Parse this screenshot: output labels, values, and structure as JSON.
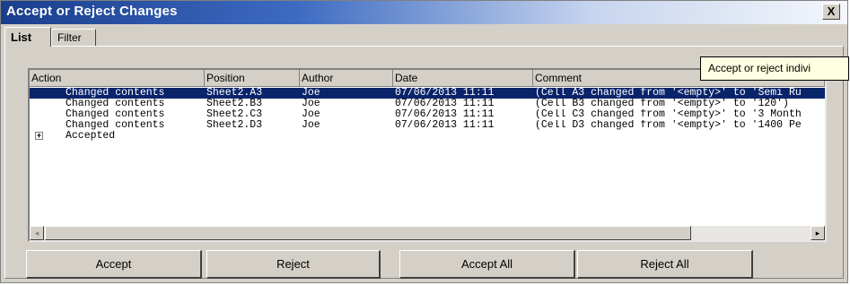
{
  "window": {
    "title": "Accept or Reject Changes",
    "close_label": "X"
  },
  "tabs": [
    {
      "label": "List",
      "active": true
    },
    {
      "label": "Filter",
      "active": false
    }
  ],
  "table": {
    "columns": [
      "Action",
      "Position",
      "Author",
      "Date",
      "Comment"
    ],
    "rows": [
      {
        "action": "Changed contents",
        "position": "Sheet2.A3",
        "author": "Joe",
        "date": "07/06/2013 11:11",
        "comment": "(Cell A3 changed from '<empty>' to 'Semi Ru",
        "selected": true
      },
      {
        "action": "Changed contents",
        "position": "Sheet2.B3",
        "author": "Joe",
        "date": "07/06/2013 11:11",
        "comment": "(Cell B3 changed from '<empty>' to '120')",
        "selected": false
      },
      {
        "action": "Changed contents",
        "position": "Sheet2.C3",
        "author": "Joe",
        "date": "07/06/2013 11:11",
        "comment": "(Cell C3 changed from '<empty>' to '3 Month",
        "selected": false
      },
      {
        "action": "Changed contents",
        "position": "Sheet2.D3",
        "author": "Joe",
        "date": "07/06/2013 11:11",
        "comment": "(Cell D3 changed from '<empty>' to '1400 Pe",
        "selected": false
      }
    ],
    "group": {
      "label": "Accepted",
      "expand_symbol": "+"
    }
  },
  "tooltip": "Accept or reject indivi",
  "scrollbar": {
    "left_arrow": "◂",
    "right_arrow": "▸"
  },
  "buttons": {
    "accept": "Accept",
    "reject": "Reject",
    "accept_all": "Accept All",
    "reject_all": "Reject All"
  },
  "colors": {
    "selection": "#0a246a",
    "title_gradient_start": "#1a3e8c",
    "tooltip_bg": "#ffffe1",
    "dialog_bg": "#d4d0c8"
  }
}
